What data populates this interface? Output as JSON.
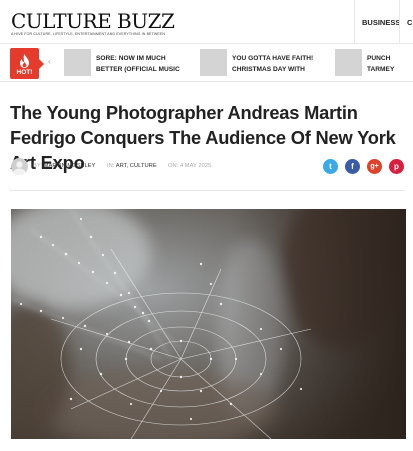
{
  "site": {
    "logo": "CULTURE BUZZ",
    "tagline": "A HIVE FOR CULTURE, LIFESTYLE, ENTERTAINMENT AND EVERYTHING IN BETWEEN"
  },
  "nav": {
    "items": [
      "BUSINESS",
      "C"
    ]
  },
  "hot": {
    "badge_label": "HOT!",
    "prev_glyph": "‹",
    "items": [
      {
        "text": "SORE: NOW IM MUCH BETTER (OFFICIAL MUSIC VIDEO PREMIERE)"
      },
      {
        "text": "YOU GOTTA HAVE FAITH! CHRISTMAS DAY WITH GEORGE MICHAEL"
      },
      {
        "text": "PUNCH TARMEY REVIEW"
      }
    ]
  },
  "article": {
    "title": "The Young Photographer Andreas Martin Fedrigo Conquers The Audience Of New York Art Expo",
    "by_label": "BY:",
    "author": "MARTIN MOSELEY",
    "in_label": "IN:",
    "categories": "ART, CULTURE",
    "on_label": "ON:",
    "date": "4 MAY 2025"
  },
  "share": [
    {
      "icon": "twitter-icon",
      "glyph": "t",
      "color": "#3aa9e8"
    },
    {
      "icon": "facebook-icon",
      "glyph": "f",
      "color": "#3b5ca8"
    },
    {
      "icon": "google-plus-icon",
      "glyph": "g+",
      "color": "#e0412d"
    },
    {
      "icon": "pinterest-icon",
      "glyph": "p",
      "color": "#d81f3e"
    }
  ],
  "colors": {
    "accent": "#e43b2c"
  }
}
